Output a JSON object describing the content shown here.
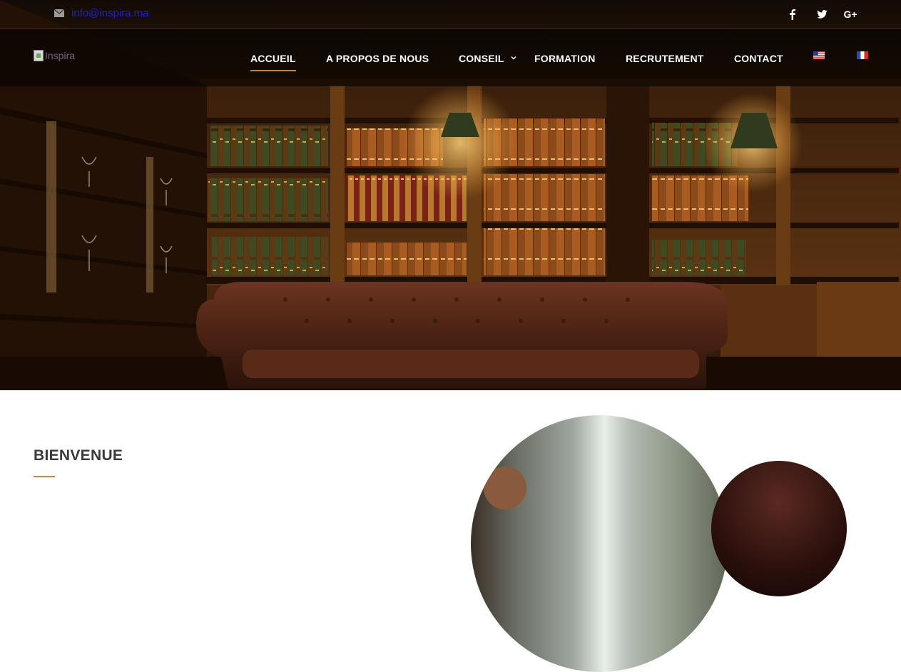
{
  "topbar": {
    "email": "info@inspira.ma",
    "social": [
      {
        "icon": "facebook-icon",
        "label": "f"
      },
      {
        "icon": "twitter-icon",
        "label": "🐦"
      },
      {
        "icon": "google-plus-icon",
        "label": "G+"
      }
    ]
  },
  "nav": {
    "logo_alt": "Inspira",
    "items": [
      {
        "label": "ACCUEIL"
      },
      {
        "label": "A PROPOS DE NOUS"
      },
      {
        "label": "CONSEIL"
      },
      {
        "label": "FORMATION"
      },
      {
        "label": "RECRUTEMENT"
      },
      {
        "label": "CONTACT"
      }
    ],
    "languages": [
      {
        "icon": "flag-us-icon",
        "lang": "English"
      },
      {
        "icon": "flag-fr-icon",
        "lang": "Français"
      }
    ]
  },
  "main": {
    "welcome_title": "BIENVENUE"
  },
  "colors": {
    "accent": "#c8853f",
    "link": "#1f1fcf",
    "nav_text": "#ffffff",
    "heading": "#3a3a3a"
  }
}
